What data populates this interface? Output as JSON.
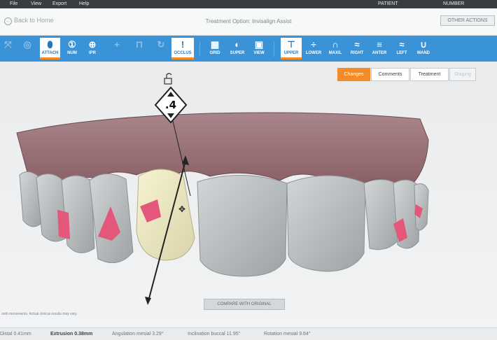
{
  "menu": {
    "file": "File",
    "view": "View",
    "export": "Export",
    "help": "Help",
    "patient": "PATIENT",
    "number": "NUMBER"
  },
  "header": {
    "back_label": "Back to Home",
    "title": "Treatment Option: Invisalign Assist",
    "other_actions": "OTHER ACTIONS"
  },
  "toolbar": {
    "tools": [
      {
        "label": "",
        "icon": "pointer-icon",
        "state": "dim"
      },
      {
        "label": "",
        "icon": "view-icon",
        "state": "dim"
      },
      {
        "label": "ATTACH",
        "icon": "attachment-icon",
        "state": "selected"
      },
      {
        "label": "NUM",
        "icon": "number-icon",
        "state": "normal"
      },
      {
        "label": "IPR",
        "icon": "ipr-icon",
        "state": "normal"
      },
      {
        "label": "",
        "icon": "plus-icon",
        "state": "dim"
      },
      {
        "label": "",
        "icon": "lock-icon",
        "state": "dim"
      },
      {
        "label": "",
        "icon": "rotate-icon",
        "state": "dim"
      },
      {
        "label": "OCCLUS",
        "icon": "occlusion-icon",
        "state": "selected"
      },
      {
        "label": "GRID",
        "icon": "grid-icon",
        "state": "normal"
      },
      {
        "label": "SUPER",
        "icon": "superimpose-icon",
        "state": "normal"
      },
      {
        "label": "VIEW",
        "icon": "view-mode-icon",
        "state": "normal"
      },
      {
        "label": "UPPER",
        "icon": "upper-icon",
        "state": "selected"
      },
      {
        "label": "LOWER",
        "icon": "lower-icon",
        "state": "normal"
      },
      {
        "label": "MAXIL",
        "icon": "maxillary-icon",
        "state": "normal"
      },
      {
        "label": "RIGHT",
        "icon": "right-icon",
        "state": "normal"
      },
      {
        "label": "ANTER",
        "icon": "anterior-icon",
        "state": "normal"
      },
      {
        "label": "LEFT",
        "icon": "left-icon",
        "state": "normal"
      },
      {
        "label": "MAND",
        "icon": "mandibular-icon",
        "state": "normal"
      }
    ]
  },
  "panel_tabs": [
    "Changes",
    "Comments",
    "Treatment",
    "Staging"
  ],
  "tooth_marker": ".4",
  "compare_button": "COMPARE WITH ORIGINAL",
  "disclaimer": "ooth movements. Actual clinical results may vary.",
  "status": {
    "distal": "Distal 0.41mm",
    "extrusion_label": "Extrusion",
    "extrusion_value": "0.38mm",
    "angulation": "Angulation mesial 3.29°",
    "inclination": "Inclination buccal 11.95°",
    "rotation": "Rotation mesial 9.64°"
  },
  "colors": {
    "toolbar": "#3a93d6",
    "accent": "#f28c28",
    "gum": "#b08d92",
    "tooth": "#c7cacb",
    "selected_tooth": "#f1edc6",
    "attachment": "#e4577a"
  }
}
